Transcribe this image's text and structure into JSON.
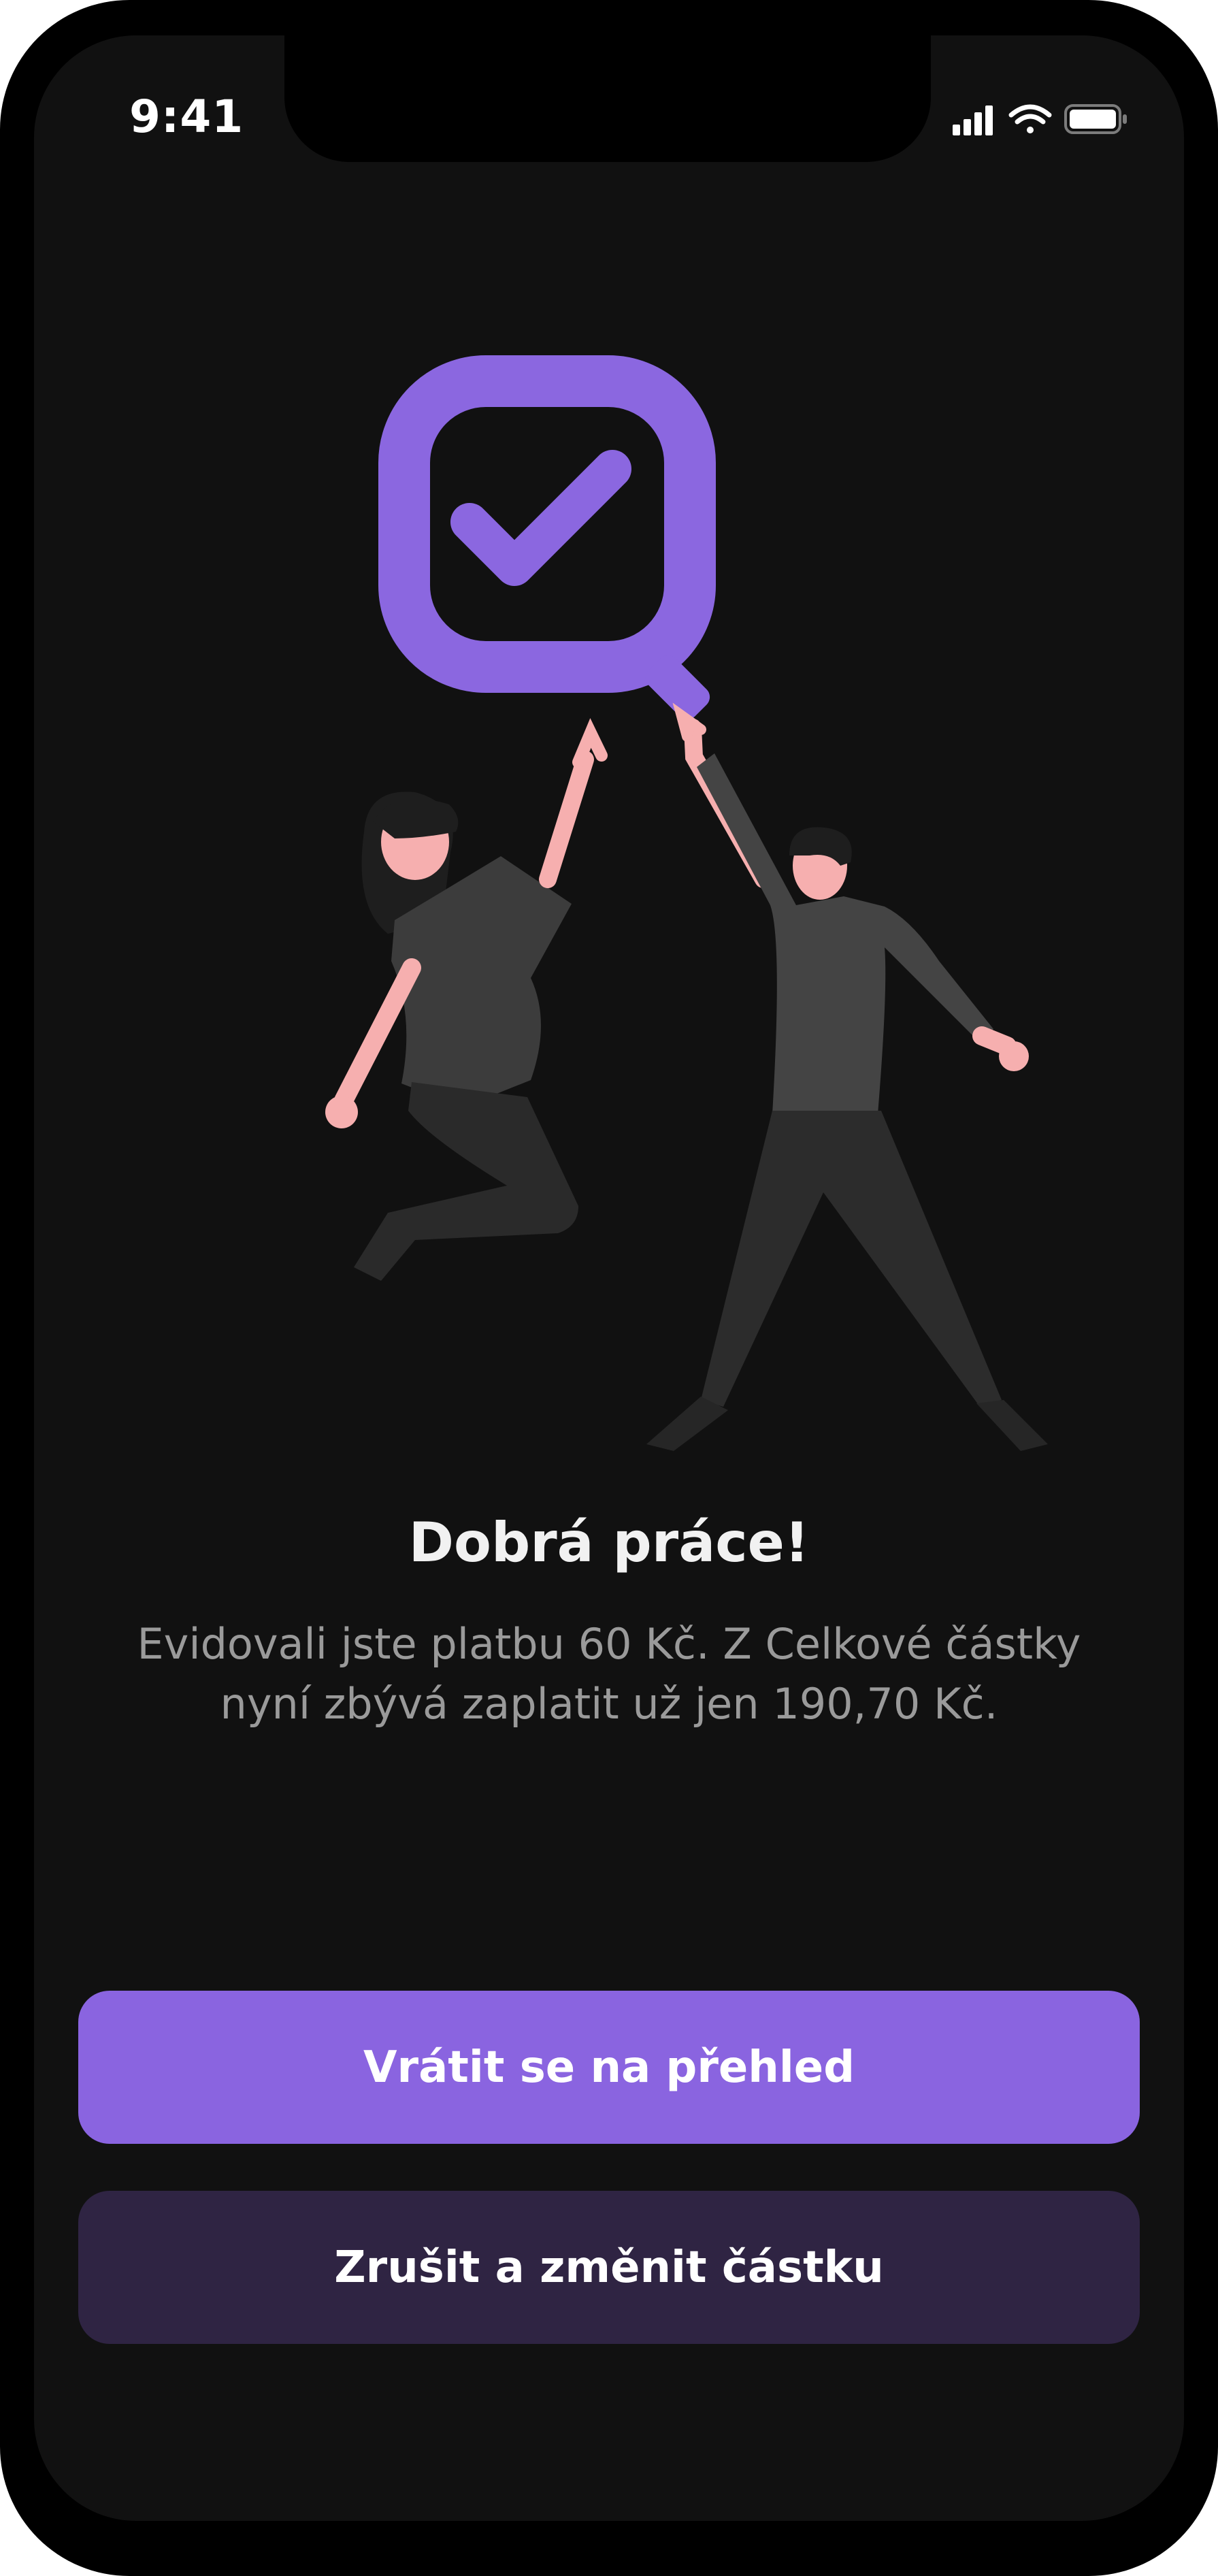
{
  "status_bar": {
    "time": "9:41",
    "signal_icon": "cellular-signal-icon",
    "wifi_icon": "wifi-icon",
    "battery_icon": "battery-icon"
  },
  "illustration": {
    "icon": "checkbox-magnifier-icon",
    "accent_color": "#8B67E0",
    "skin_color": "#F6AFAF"
  },
  "success": {
    "title": "Dobrá práce!",
    "message": "Evidovali jste platbu 60 Kč. Z Celkové částky nyní zbývá zaplatit už jen 190,70 Kč."
  },
  "actions": {
    "primary_label": "Vrátit se na přehled",
    "secondary_label": "Zrušit a změnit částku"
  },
  "colors": {
    "background": "#111111",
    "primary_button": "#8A64E0",
    "secondary_button": "#2F2443",
    "title_text": "#F1F1F1",
    "body_text": "#9A9A9A"
  }
}
